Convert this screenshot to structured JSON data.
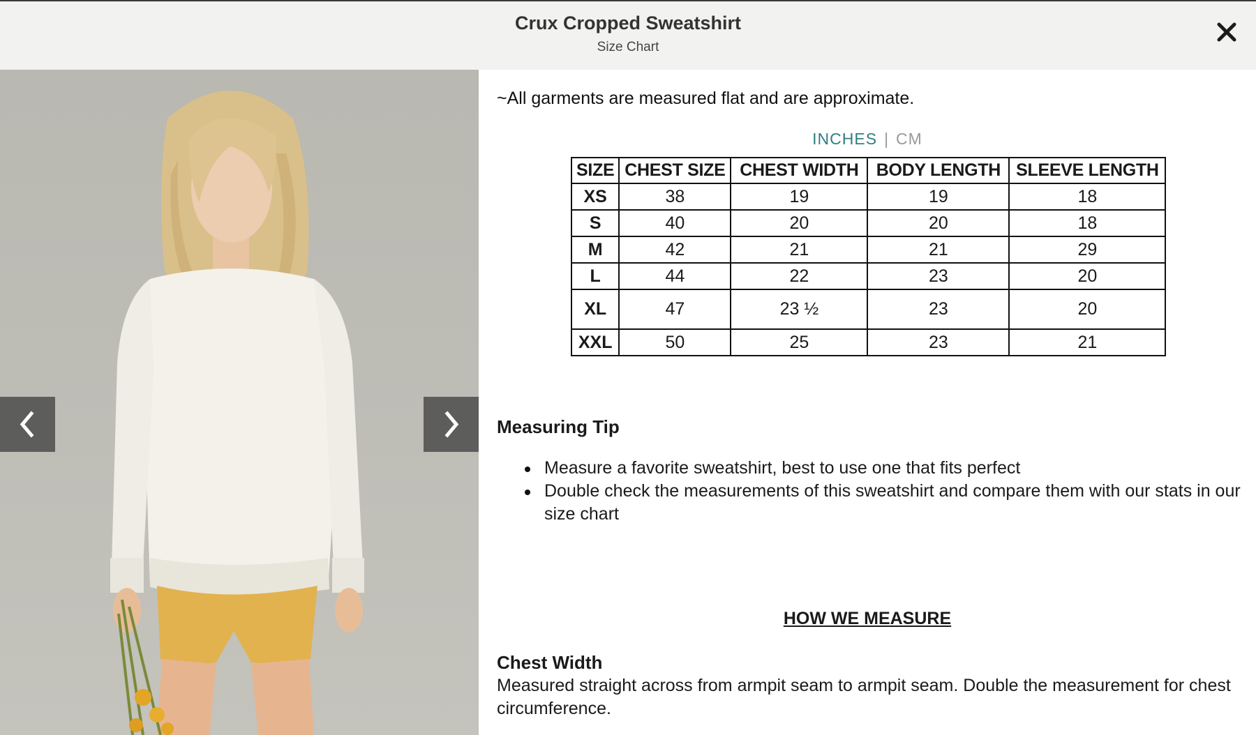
{
  "header": {
    "title": "Crux Cropped Sweatshirt",
    "subtitle": "Size Chart",
    "close_icon": "close-icon"
  },
  "gallery": {
    "image_alt": "Model wearing cream cropped sweatshirt and yellow shorts holding yellow flowers",
    "prev_icon": "chevron-left-icon",
    "next_icon": "chevron-right-icon"
  },
  "note": "~All garments are measured flat and are approximate.",
  "units": {
    "active": "INCHES",
    "separator": "|",
    "inactive": "CM",
    "active_color": "#2f7f80"
  },
  "size_table": {
    "headers": [
      "SIZE",
      "CHEST SIZE",
      "CHEST WIDTH",
      "BODY LENGTH",
      "SLEEVE LENGTH"
    ],
    "rows": [
      [
        "XS",
        "38",
        "19",
        "19",
        "18"
      ],
      [
        "S",
        "40",
        "20",
        "20",
        "18"
      ],
      [
        "M",
        "42",
        "21",
        "21",
        "29"
      ],
      [
        "L",
        "44",
        "22",
        "23",
        "20"
      ],
      [
        "XL",
        "47",
        "23 ½",
        "23",
        "20"
      ],
      [
        "XXL",
        "50",
        "25",
        "23",
        "21"
      ]
    ]
  },
  "measuring_tip": {
    "heading": "Measuring Tip",
    "items": [
      "Measure a favorite sweatshirt, best to use one that fits perfect",
      "Double check the measurements of this sweatshirt and compare them with our stats in our size chart"
    ]
  },
  "how_we_measure": {
    "heading": "HOW WE MEASURE",
    "chest_width_heading": "Chest Width",
    "chest_width_text": "Measured straight across from armpit seam to armpit seam. Double the measurement for chest circumference."
  }
}
